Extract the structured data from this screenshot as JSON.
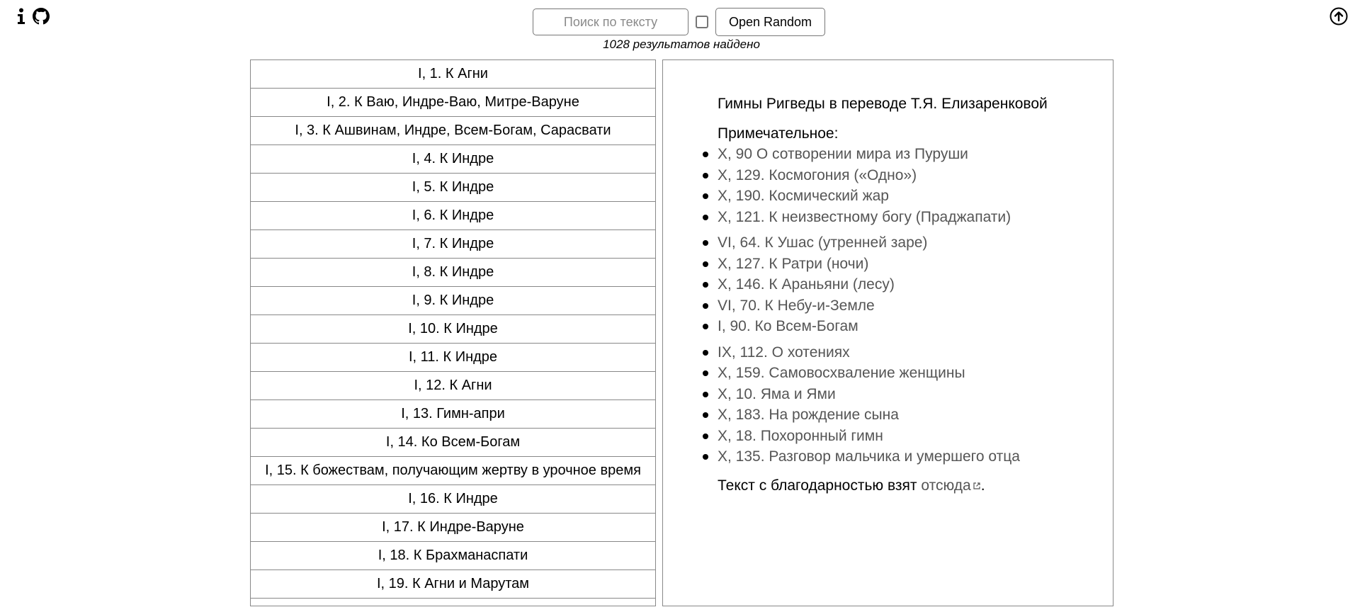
{
  "header": {
    "search": {
      "placeholder": "Поиск по тексту",
      "value": ""
    },
    "open_random_label": "Open Random",
    "results_text": "1028 результатов найдено"
  },
  "icons": {
    "info": "info-icon",
    "github": "github-icon",
    "scroll_top": "arrow-up-circle-icon",
    "external_link": "external-link-icon"
  },
  "hymn_list": [
    "I, 1. К Агни",
    "I, 2. К Ваю, Индре-Ваю, Митре-Варуне",
    "I, 3. К Ашвинам, Индре, Всем-Богам, Сарасвати",
    "I, 4. К Индре",
    "I, 5. К Индре",
    "I, 6. К Индре",
    "I, 7. К Индре",
    "I, 8. К Индре",
    "I, 9. К Индре",
    "I, 10. К Индре",
    "I, 11. К Индре",
    "I, 12. К Агни",
    "I, 13. Гимн-апри",
    "I, 14. Ко Всем-Богам",
    "I, 15. К божествам, получающим жертву в урочное время",
    "I, 16. К Индре",
    "I, 17. К Индре-Варуне",
    "I, 18. К Брахманаспати",
    "I, 19. К Агни и Марутам"
  ],
  "detail": {
    "title": "Гимны Ригведы в переводе Т.Я. Елизаренковой",
    "notable_label": "Примечательное:",
    "groups": [
      [
        "X, 90 О сотворении мира из Пуруши",
        "X, 129. Космогония («Одно»)",
        "X, 190. Космический жар",
        "X, 121. К неизвестному богу (Праджапати)"
      ],
      [
        "VI, 64. К Ушас (утренней заре)",
        "X, 127. К Ратри (ночи)",
        "X, 146. К Араньяни (лесу)",
        "VI, 70. К Небу-и-Земле",
        "I, 90. Ко Всем-Богам"
      ],
      [
        "IX, 112. О хотениях",
        "X, 159. Самовосхваление женщины",
        "X, 10. Яма и Ями",
        "X, 183. На рождение сына",
        "X, 18. Похоронный гимн",
        "X, 135. Разговор мальчика и умершего отца"
      ]
    ],
    "credit_prefix": "Текст с благодарностью взят ",
    "credit_link": "отсюда",
    "credit_suffix": "."
  }
}
